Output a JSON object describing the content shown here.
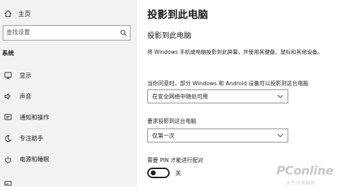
{
  "sidebar": {
    "home_label": "主页",
    "search_placeholder": "查找设置",
    "section_label": "系统",
    "items": [
      {
        "label": "显示",
        "icon": "display-icon"
      },
      {
        "label": "声音",
        "icon": "speaker-icon"
      },
      {
        "label": "通知和操作",
        "icon": "notification-icon"
      },
      {
        "label": "专注助手",
        "icon": "moon-icon"
      },
      {
        "label": "电源和睡眠",
        "icon": "power-icon"
      },
      {
        "label": "",
        "icon": "storage-icon"
      }
    ]
  },
  "main": {
    "page_title": "投影到此电脑",
    "section_title": "投影到此电脑",
    "description": "将 Windows 手机或电脑投影到此屏幕，并使用其键盘、鼠标和其他设备。",
    "setting1": {
      "label": "当你同意时，部分 Windows 和 Android 设备可以投影到这台电脑",
      "value": "在安全网络中随处可用"
    },
    "setting2": {
      "label": "要求投影到这台电脑",
      "value": "仅第一次"
    },
    "setting3": {
      "label": "需要 PIN 才能进行配对",
      "toggle_label": "关",
      "toggle_on": false
    }
  },
  "watermark": {
    "main": "PConline",
    "sub": "太平洋电脑网"
  },
  "colors": {
    "sidebar_bg": "#f2f2f2",
    "main_bg": "#ffffff",
    "text": "#1a1a1a"
  }
}
